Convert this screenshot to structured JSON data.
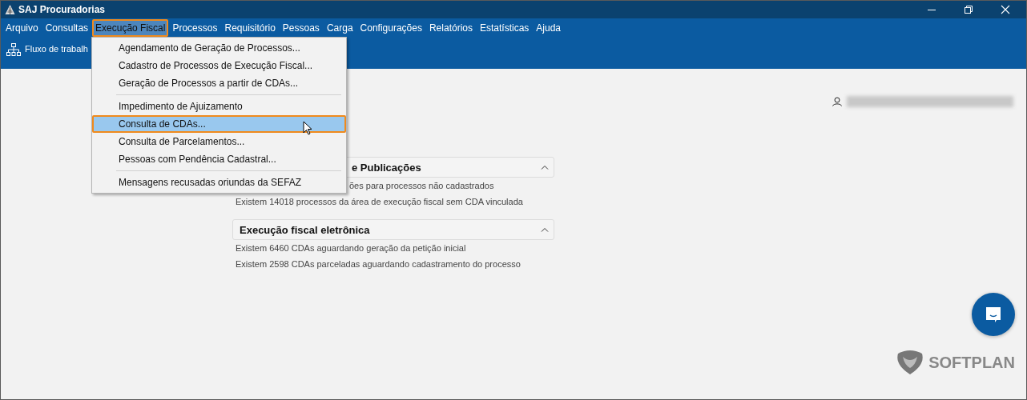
{
  "window": {
    "title": "SAJ Procuradorias"
  },
  "menu_bar": [
    {
      "label": "Arquivo",
      "selected": false
    },
    {
      "label": "Consultas",
      "selected": false
    },
    {
      "label": "Execução Fiscal",
      "selected": true
    },
    {
      "label": "Processos",
      "selected": false
    },
    {
      "label": "Requisitório",
      "selected": false
    },
    {
      "label": "Pessoas",
      "selected": false
    },
    {
      "label": "Carga",
      "selected": false
    },
    {
      "label": "Configurações",
      "selected": false
    },
    {
      "label": "Relatórios",
      "selected": false
    },
    {
      "label": "Estatísticas",
      "selected": false
    },
    {
      "label": "Ajuda",
      "selected": false
    }
  ],
  "toolbar": {
    "label": "Fluxo de trabalh"
  },
  "dropdown_menu": [
    {
      "kind": "item",
      "label": "Agendamento de Geração de Processos...",
      "selected": false
    },
    {
      "kind": "item",
      "label": "Cadastro de Processos de Execução Fiscal...",
      "selected": false
    },
    {
      "kind": "item",
      "label": "Geração de Processos a partir de CDAs...",
      "selected": false
    },
    {
      "kind": "separator"
    },
    {
      "kind": "item",
      "label": "Impedimento de Ajuizamento",
      "selected": false
    },
    {
      "kind": "item",
      "label": "Consulta de CDAs...",
      "selected": true
    },
    {
      "kind": "item",
      "label": "Consulta de Parcelamentos...",
      "selected": false
    },
    {
      "kind": "item",
      "label": "Pessoas com Pendência Cadastral...",
      "selected": false
    },
    {
      "kind": "separator"
    },
    {
      "kind": "item",
      "label": "Mensagens recusadas oriundas da SEFAZ",
      "selected": false
    }
  ],
  "sections": [
    {
      "title": "e Publicações",
      "expanded": true,
      "lines": [
        "ões para processos não cadastrados",
        "Existem  14018 processos da área de execução fiscal sem CDA vinculada"
      ]
    },
    {
      "title": "Execução fiscal eletrônica",
      "expanded": true,
      "lines": [
        "Existem  6460 CDAs aguardando geração da petição inicial",
        "Existem  2598 CDAs parceladas aguardando cadastramento do processo"
      ]
    }
  ],
  "logo": {
    "text": "SOFTPLAN"
  }
}
